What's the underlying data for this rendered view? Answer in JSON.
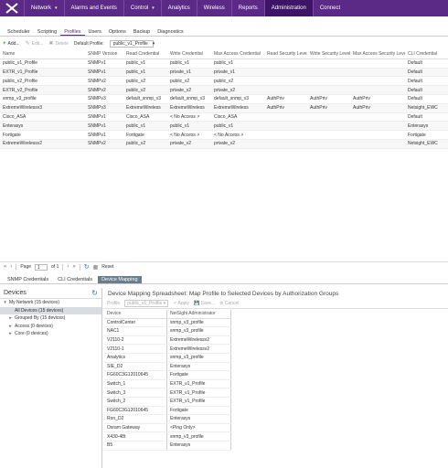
{
  "nav": {
    "items": [
      {
        "label": "Network",
        "caret": true,
        "active": false
      },
      {
        "label": "Alarms and Events",
        "caret": false,
        "active": false
      },
      {
        "label": "Control",
        "caret": true,
        "active": false
      },
      {
        "label": "Analytics",
        "caret": false,
        "active": false
      },
      {
        "label": "Wireless",
        "caret": false,
        "active": false
      },
      {
        "label": "Reports",
        "caret": false,
        "active": false
      },
      {
        "label": "Administration",
        "caret": false,
        "active": true
      },
      {
        "label": "Connect",
        "caret": false,
        "active": false
      }
    ],
    "accent": "#5b2a86"
  },
  "subtabs": [
    "Scheduler",
    "Scripting",
    "Profiles",
    "Users",
    "Options",
    "Backup",
    "Diagnostics"
  ],
  "active_subtab": "Profiles",
  "toolbar": {
    "add": "Add...",
    "edit": "Edit...",
    "delete": "Delete",
    "default_profile_label": "Default Profile:",
    "default_profile_value": "public_v1_Profile"
  },
  "grid": {
    "columns": [
      "Name",
      "SNMP Version",
      "Read Credential",
      "Write Credential",
      "Max Access Credential",
      "Read Security Level",
      "Write Security Level",
      "Max Access Security Level",
      "CLI Credential"
    ],
    "rows": [
      [
        "public_v1_Profile",
        "SNMPv1",
        "public_v1",
        "public_v1",
        "public_v1",
        "",
        "",
        "",
        "Default"
      ],
      [
        "EXTR_v1_Profile",
        "SNMPv1",
        "public_v1",
        "private_v1",
        "private_v1",
        "",
        "",
        "",
        "Default"
      ],
      [
        "public_v2_Profile",
        "SNMPv2",
        "public_v2",
        "public_v2",
        "public_v2",
        "",
        "",
        "",
        "Default"
      ],
      [
        "EXTR_v2_Profile",
        "SNMPv2",
        "public_v2",
        "private_v2",
        "private_v2",
        "",
        "",
        "",
        "Default"
      ],
      [
        "snmp_v3_profile",
        "SNMPv3",
        "default_snmp_v3",
        "default_snmp_v3",
        "default_snmp_v3",
        "AuthPriv",
        "AuthPriv",
        "AuthPriv",
        "Default"
      ],
      [
        "ExtremeWirelessv3",
        "SNMPv3",
        "ExtremeWireless",
        "ExtremeWireless",
        "ExtremeWireless",
        "AuthPriv",
        "AuthPriv",
        "AuthPriv",
        "Netsight_EWC"
      ],
      [
        "Cisco_ASA",
        "SNMPv1",
        "Cisco_ASA",
        "< No Access >",
        "Cisco_ASA",
        "",
        "",
        "",
        "Default"
      ],
      [
        "Enterasys",
        "SNMPv1",
        "public_v1",
        "public_v1",
        "public_v1",
        "",
        "",
        "",
        "Enterasys"
      ],
      [
        "Fortigate",
        "SNMPv1",
        "Fortigate",
        "< No Access >",
        "< No Access >",
        "",
        "",
        "",
        "Fortigate"
      ],
      [
        "ExtremeWirelessv2",
        "SNMPv2",
        "public_v2",
        "private_v2",
        "private_v2",
        "",
        "",
        "",
        "Netsight_EWC"
      ]
    ]
  },
  "pager": {
    "page_label": "Page",
    "page_value": "1",
    "of_label": "of 1",
    "reset": "Reset"
  },
  "bottom_tabs": [
    "SNMP Credentials",
    "CLI Credentials",
    "Device Mapping"
  ],
  "active_bottom_tab": "Device Mapping",
  "devices": {
    "title": "Devices",
    "tree": [
      {
        "label": "My Network (15 devices)",
        "level": 0,
        "twisty": "v",
        "selected": false
      },
      {
        "label": "All Devices (15 devices)",
        "level": 1,
        "twisty": "",
        "selected": true
      },
      {
        "label": "Grouped By (15 devices)",
        "level": 1,
        "twisty": ">",
        "selected": false
      },
      {
        "label": "Access (0 devices)",
        "level": 1,
        "twisty": ">",
        "selected": false
      },
      {
        "label": "Core (0 devices)",
        "level": 1,
        "twisty": ">",
        "selected": false
      }
    ]
  },
  "mapping": {
    "title": "Device Mapping Spreadsheet: Map Profile to Selected Devices by Authorization Groups",
    "profile_label": "Profile",
    "profile_value": "public_v1_Profile",
    "apply": "Apply",
    "save": "Save...",
    "cancel": "Cancel",
    "columns": [
      "Device",
      "NetSight Administrator"
    ],
    "rows": [
      [
        "ControlCenter",
        "snmp_v3_profile"
      ],
      [
        "NAC1",
        "snmp_v3_profile"
      ],
      [
        "V2110-2",
        "ExtremeWirelessv2"
      ],
      [
        "V2110-1",
        "ExtremeWirelessv2"
      ],
      [
        "Analytics",
        "snmp_v3_profile"
      ],
      [
        "SIE_D2",
        "Enterasys"
      ],
      [
        "FG60C3G12010645",
        "Fortigate"
      ],
      [
        "Switch_1",
        "EXTR_v1_Profile"
      ],
      [
        "Switch_3",
        "EXTR_v1_Profile"
      ],
      [
        "Switch_2",
        "EXTR_v1_Profile"
      ],
      [
        "FG60C3G12010645",
        "Fortigate"
      ],
      [
        "Ron_D2",
        "Enterasys"
      ],
      [
        "Osram Gateway",
        "<Ping Only>"
      ],
      [
        "X430-48t",
        "snmp_v3_profile"
      ],
      [
        "B5",
        "Enterasys"
      ]
    ]
  }
}
